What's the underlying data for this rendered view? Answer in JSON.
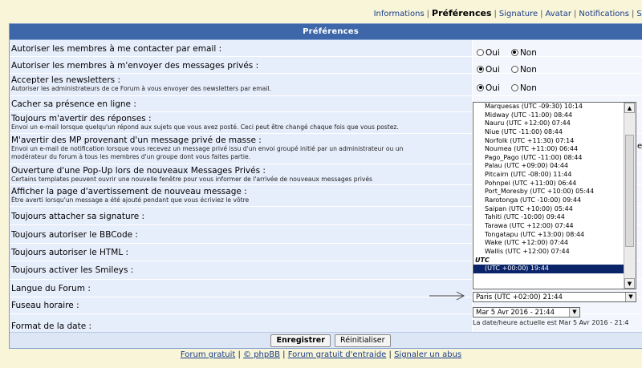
{
  "tabs": [
    {
      "label": "Informations",
      "active": false
    },
    {
      "label": "Préférences",
      "active": true
    },
    {
      "label": "Signature",
      "active": false
    },
    {
      "label": "Avatar",
      "active": false
    },
    {
      "label": "Notifications",
      "active": false
    },
    {
      "label": "Su",
      "active": false
    }
  ],
  "panel": {
    "title": "Préférences"
  },
  "radio": {
    "oui": "Oui",
    "non": "Non"
  },
  "rows": [
    {
      "label": "Autoriser les membres à me contacter par email :",
      "desc": "",
      "selected": "non"
    },
    {
      "label": "Autoriser les membres à m'envoyer des messages privés :",
      "desc": "",
      "selected": "oui"
    },
    {
      "label": "Accepter les newsletters :",
      "desc": "Autoriser les administrateurs de ce Forum à vous envoyer des newsletters par email.",
      "selected": "oui"
    },
    {
      "label": "Cacher sa présence en ligne :",
      "desc": "",
      "selected": ""
    },
    {
      "label": "Toujours m'avertir des réponses :",
      "desc": "Envoi un e-mail lorsque quelqu'un répond aux sujets que vous avez posté. Ceci peut être changé chaque fois que vous postez.",
      "selected": ""
    },
    {
      "label": "M'avertir des MP provenant d'un message privé de masse :",
      "desc": "Envoi un e-mail de notification lorsque vous recevez un message privé issu d'un envoi groupé initié par un administrateur ou un",
      "desc2": "modérateur du forum à tous les membres d'un groupe dont vous faites partie.",
      "selected": ""
    },
    {
      "label": "Ouverture d'une Pop-Up lors de nouveaux Messages Privés :",
      "desc": "Certains templates peuvent ouvrir une nouvelle fenêtre pour vous informer de l'arrivée de nouveaux messages privés",
      "selected": ""
    },
    {
      "label": "Afficher la page d'avertissement de nouveau message :",
      "desc": "Être averti lorsqu'un message a été ajouté pendant que vous écriviez le vôtre",
      "selected": ""
    },
    {
      "label": "Toujours attacher sa signature :",
      "desc": "",
      "selected": ""
    },
    {
      "label": "Toujours autoriser le BBCode :",
      "desc": "",
      "selected": ""
    },
    {
      "label": "Toujours autoriser le HTML :",
      "desc": "",
      "selected": ""
    },
    {
      "label": "Toujours activer les Smileys :",
      "desc": "",
      "selected": ""
    },
    {
      "label": "Langue du Forum :",
      "desc": "",
      "selected": ""
    },
    {
      "label": "Fuseau horaire :",
      "desc": "",
      "selected": ""
    },
    {
      "label": "Format de la date :",
      "desc": "",
      "selected": ""
    }
  ],
  "timezone": {
    "options": [
      "Marquesas (UTC -09:30) 10:14",
      "Midway (UTC -11:00) 08:44",
      "Nauru (UTC +12:00) 07:44",
      "Niue (UTC -11:00) 08:44",
      "Norfolk (UTC +11:30) 07:14",
      "Noumea (UTC +11:00) 06:44",
      "Pago_Pago (UTC -11:00) 08:44",
      "Palau (UTC +09:00) 04:44",
      "Pitcairn (UTC -08:00) 11:44",
      "Pohnpei (UTC +11:00) 06:44",
      "Port_Moresby (UTC +10:00) 05:44",
      "Rarotonga (UTC -10:00) 09:44",
      "Saipan (UTC +10:00) 05:44",
      "Tahiti (UTC -10:00) 09:44",
      "Tarawa (UTC +12:00) 07:44",
      "Tongatapu (UTC +13:00) 08:44",
      "Wake (UTC +12:00) 07:44",
      "Wallis (UTC +12:00) 07:44"
    ],
    "group_label": "UTC",
    "highlighted": "(UTC +00:00) 19:44",
    "current": "Paris (UTC +02:00) 21:44"
  },
  "date_format": {
    "current": "Mar 5 Avr 2016 - 21:44",
    "note": "La date/heure actuelle est Mar 5 Avr 2016 - 21:4"
  },
  "cut_text": "ed",
  "buttons": {
    "submit": "Enregistrer",
    "reset": "Réinitialiser"
  },
  "footer": {
    "links": [
      "Forum gratuit",
      "© phpBB",
      "Forum gratuit d'entraide",
      "Signaler un abus"
    ]
  }
}
